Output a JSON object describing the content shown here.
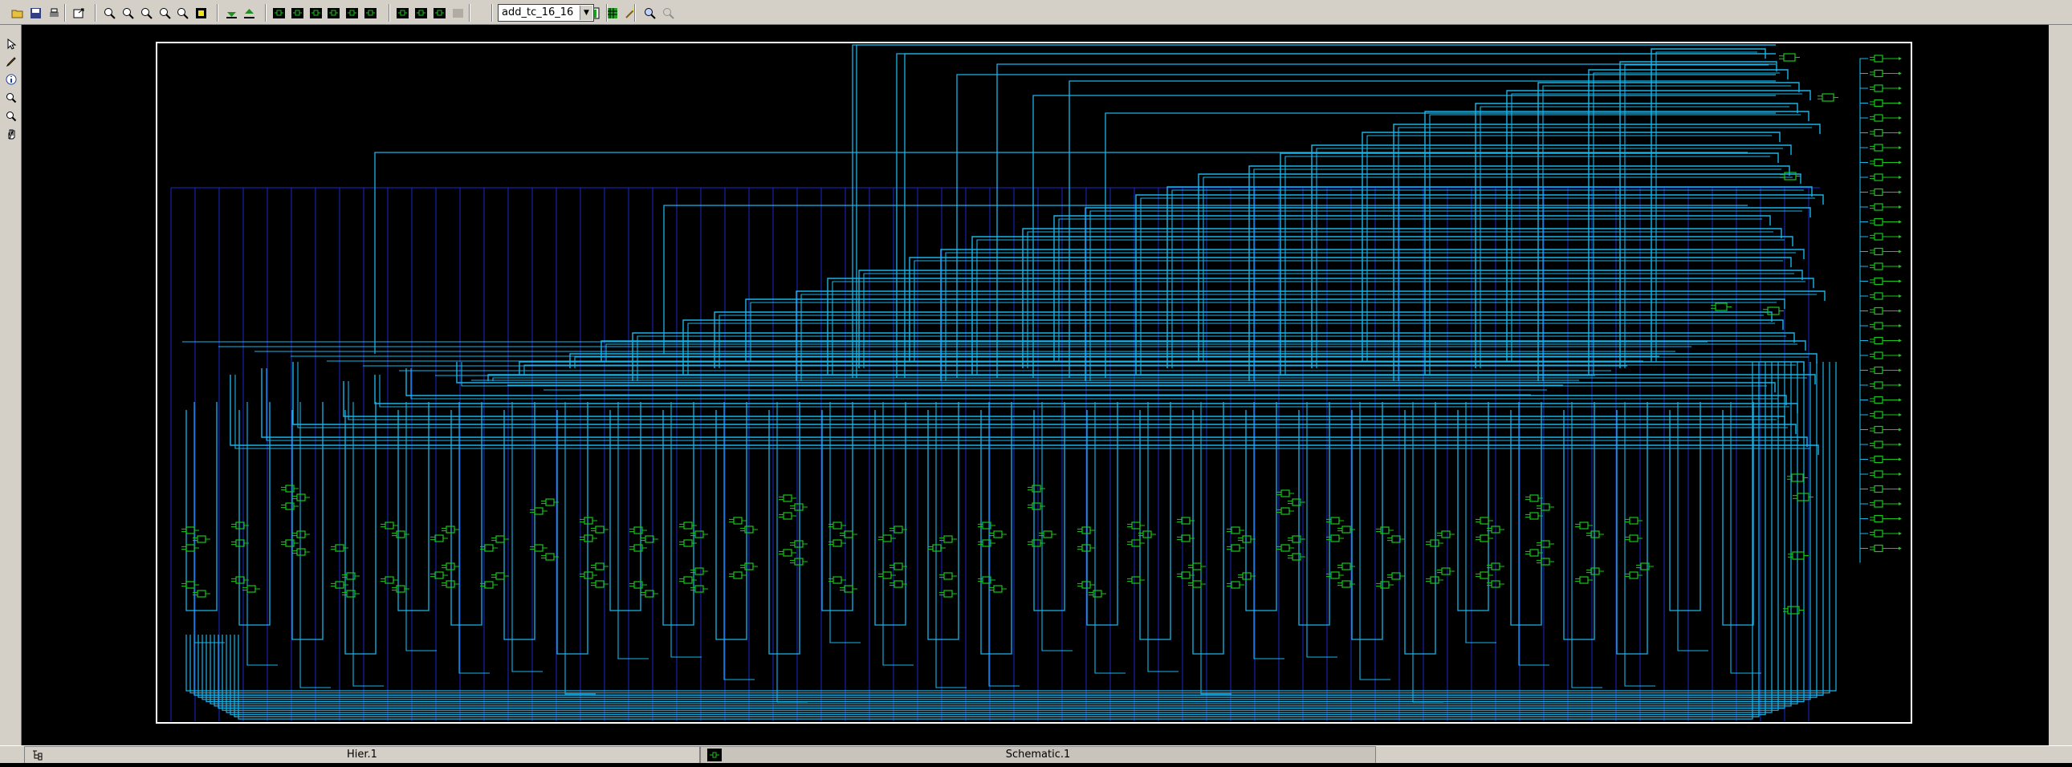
{
  "toolbar": {
    "design_select": {
      "value": "add_tc_16_16"
    },
    "buttons": [
      {
        "name": "open-folder-icon"
      },
      {
        "name": "save-icon"
      },
      {
        "name": "print-icon"
      },
      {
        "name": "export-icon"
      },
      {
        "name": "zoom-fit-icon"
      },
      {
        "name": "zoom-in-icon"
      },
      {
        "name": "zoom-out-icon"
      },
      {
        "name": "zoom-area-icon"
      },
      {
        "name": "zoom-previous-icon"
      },
      {
        "name": "highlight-icon"
      },
      {
        "name": "push-down-icon"
      },
      {
        "name": "pop-up-icon"
      },
      {
        "name": "schematic-view-icon"
      },
      {
        "name": "schematic-fanin-icon"
      },
      {
        "name": "schematic-fanout-icon"
      },
      {
        "name": "schematic-path-icon"
      },
      {
        "name": "schematic-cell-icon"
      },
      {
        "name": "schematic-net-icon"
      },
      {
        "name": "new-schematic-icon"
      },
      {
        "name": "new-symbol-icon"
      },
      {
        "name": "new-path-icon"
      },
      {
        "name": "disabled-tool-icon"
      },
      {
        "name": "histogram-icon"
      },
      {
        "name": "grid-icon"
      },
      {
        "name": "wand-icon"
      },
      {
        "name": "query-icon"
      },
      {
        "name": "query-disabled-icon"
      }
    ]
  },
  "left_toolbar": {
    "buttons": [
      {
        "name": "select-pointer-icon"
      },
      {
        "name": "pencil-icon"
      },
      {
        "name": "info-icon"
      },
      {
        "name": "zoom-in-icon"
      },
      {
        "name": "zoom-out-icon"
      },
      {
        "name": "pan-hand-icon"
      }
    ]
  },
  "colors": {
    "background": "#000000",
    "wire": "#1ab4e8",
    "bus": "#1a2ad0",
    "gate": "#19c619",
    "frame": "#ffffff",
    "ui_gray": "#d4d0c8"
  },
  "tabs": [
    {
      "label": "Hier.1",
      "active": false
    },
    {
      "label": "Schematic.1",
      "active": true
    }
  ]
}
